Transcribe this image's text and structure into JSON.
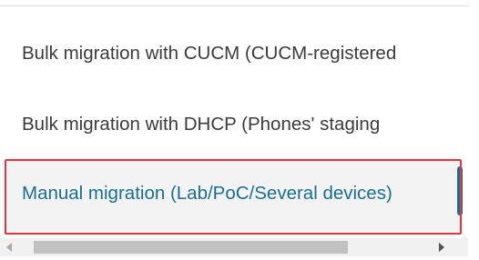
{
  "options": {
    "items": [
      {
        "label": "Bulk migration with CUCM (CUCM-registered"
      },
      {
        "label": "Bulk migration with DHCP (Phones' staging"
      },
      {
        "label": "Manual migration (Lab/PoC/Several devices)",
        "selected": true
      }
    ]
  },
  "colors": {
    "selected_text": "#1a6e93",
    "selected_background": "#f3f3f3",
    "highlight_border": "#e8343a",
    "default_text": "#3b3b3b"
  },
  "scrollbar": {
    "position_fraction": 0.07,
    "visible_fraction": 0.76
  }
}
